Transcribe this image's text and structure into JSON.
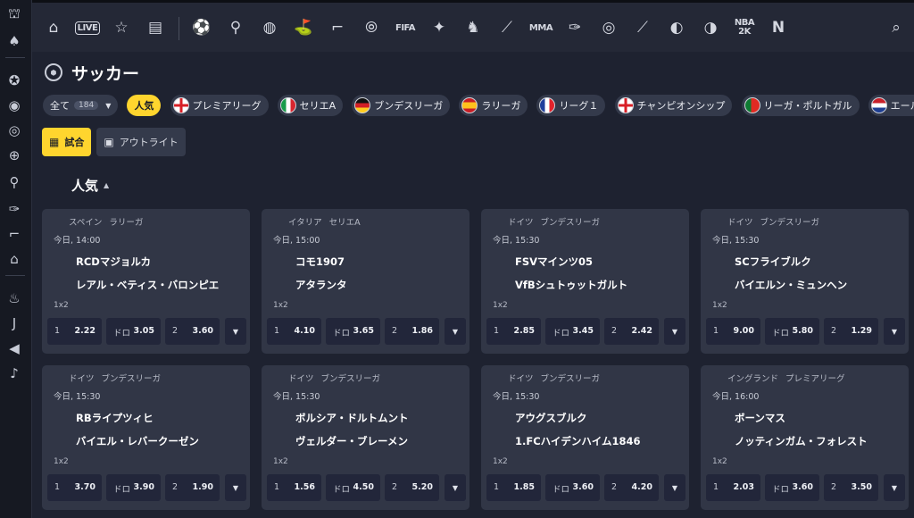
{
  "page": {
    "title": "サッカー"
  },
  "rail": {
    "icons": [
      "casino-icon",
      "cards-icon",
      "star-circle-icon",
      "live-broadcast-icon",
      "target-icon",
      "basketball-icon",
      "tennis-icon",
      "badminton-icon",
      "hockey-icon",
      "stadium-icon",
      "fire-icon",
      "juventus-icon",
      "megaphone-icon",
      "whistle-icon"
    ]
  },
  "topbar": {
    "live_label": "LIVE",
    "fifa_label": "FIFA",
    "mma_label": "MMA",
    "nba_label": "NBA",
    "nba_year": "2K"
  },
  "filters": {
    "all_label": "全て",
    "all_count": "184",
    "popular_label": "人気",
    "leagues": [
      {
        "label": "プレミアリーグ",
        "flag": "england"
      },
      {
        "label": "セリエA",
        "flag": "italy"
      },
      {
        "label": "ブンデスリーガ",
        "flag": "germany"
      },
      {
        "label": "ラリーガ",
        "flag": "spain"
      },
      {
        "label": "リーグ１",
        "flag": "france"
      },
      {
        "label": "チャンピオンシップ",
        "flag": "england"
      },
      {
        "label": "リーガ・ポルトガル",
        "flag": "portugal"
      },
      {
        "label": "エール",
        "flag": "netherlands"
      }
    ]
  },
  "view": {
    "matches_label": "試合",
    "outright_label": "アウトライト"
  },
  "section": {
    "title": "人気"
  },
  "accent_color": "#ffd52e",
  "matches": [
    {
      "country": "スペイン",
      "league": "ラリーガ",
      "time": "今日, 14:00",
      "home": "RCDマジョルカ",
      "away": "レアル・ベティス・バロンピエ",
      "market": "1x2",
      "odds": {
        "home_label": "1",
        "home": "2.22",
        "draw_label": "ドロ",
        "draw": "3.05",
        "away_label": "2",
        "away": "3.60"
      }
    },
    {
      "country": "イタリア",
      "league": "セリエA",
      "time": "今日, 15:00",
      "home": "コモ1907",
      "away": "アタランタ",
      "market": "1x2",
      "odds": {
        "home_label": "1",
        "home": "4.10",
        "draw_label": "ドロ",
        "draw": "3.65",
        "away_label": "2",
        "away": "1.86"
      }
    },
    {
      "country": "ドイツ",
      "league": "ブンデスリーガ",
      "time": "今日, 15:30",
      "home": "FSVマインツ05",
      "away": "VfBシュトゥットガルト",
      "market": "1x2",
      "odds": {
        "home_label": "1",
        "home": "2.85",
        "draw_label": "ドロ",
        "draw": "3.45",
        "away_label": "2",
        "away": "2.42"
      }
    },
    {
      "country": "ドイツ",
      "league": "ブンデスリーガ",
      "time": "今日, 15:30",
      "home": "SCフライブルク",
      "away": "バイエルン・ミュンヘン",
      "market": "1x2",
      "odds": {
        "home_label": "1",
        "home": "9.00",
        "draw_label": "ドロ",
        "draw": "5.80",
        "away_label": "2",
        "away": "1.29"
      }
    },
    {
      "country": "ドイツ",
      "league": "ブンデスリーガ",
      "time": "今日, 15:30",
      "home": "RBライプツィヒ",
      "away": "バイエル・レバークーゼン",
      "market": "1x2",
      "odds": {
        "home_label": "1",
        "home": "3.70",
        "draw_label": "ドロ",
        "draw": "3.90",
        "away_label": "2",
        "away": "1.90"
      }
    },
    {
      "country": "ドイツ",
      "league": "ブンデスリーガ",
      "time": "今日, 15:30",
      "home": "ボルシア・ドルトムント",
      "away": "ヴェルダー・ブレーメン",
      "market": "1x2",
      "odds": {
        "home_label": "1",
        "home": "1.56",
        "draw_label": "ドロ",
        "draw": "4.50",
        "away_label": "2",
        "away": "5.20"
      }
    },
    {
      "country": "ドイツ",
      "league": "ブンデスリーガ",
      "time": "今日, 15:30",
      "home": "アウグスブルク",
      "away": "1.FCハイデンハイム1846",
      "market": "1x2",
      "odds": {
        "home_label": "1",
        "home": "1.85",
        "draw_label": "ドロ",
        "draw": "3.60",
        "away_label": "2",
        "away": "4.20"
      }
    },
    {
      "country": "イングランド",
      "league": "プレミアリーグ",
      "time": "今日, 16:00",
      "home": "ボーンマス",
      "away": "ノッティンガム・フォレスト",
      "market": "1x2",
      "odds": {
        "home_label": "1",
        "home": "2.03",
        "draw_label": "ドロ",
        "draw": "3.60",
        "away_label": "2",
        "away": "3.50"
      }
    }
  ]
}
